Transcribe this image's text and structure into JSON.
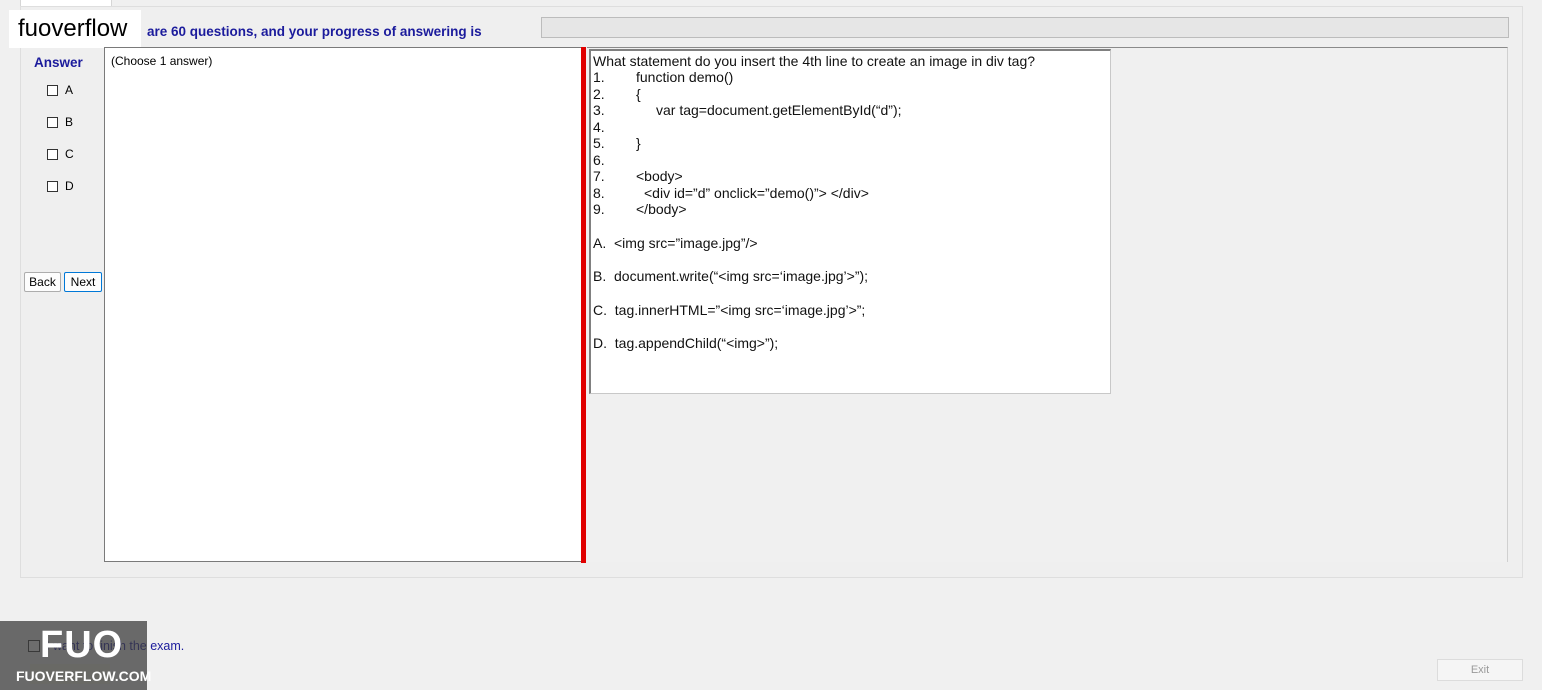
{
  "logo": {
    "text": "fuoverflow"
  },
  "header": {
    "progress_label": "are 60 questions, and your progress of answering is"
  },
  "answer_panel": {
    "title": "Answer",
    "options": [
      "A",
      "B",
      "C",
      "D"
    ]
  },
  "nav": {
    "back_label": "Back",
    "next_label": "Next"
  },
  "choose_panel": {
    "text": "(Choose 1 answer)"
  },
  "question": {
    "stem": "What statement do you insert the 4th line to create an image in div tag?",
    "lines": [
      {
        "num": "1.",
        "code": "function demo()"
      },
      {
        "num": "2.",
        "code": "{"
      },
      {
        "num": "3.",
        "code": "var tag=document.getElementById(“d”);"
      },
      {
        "num": "4.",
        "code": ""
      },
      {
        "num": "5.",
        "code": "}"
      },
      {
        "num": "6.",
        "code": ""
      },
      {
        "num": "7.",
        "code": "<body>"
      },
      {
        "num": "8.",
        "code": "<div id=”d” onclick=”demo()”> </div>"
      },
      {
        "num": "9.",
        "code": "</body>"
      }
    ],
    "choices": [
      "A.  <img src=”image.jpg”/>",
      "B.  document.write(“<img src=‘image.jpg’>”);",
      "C.  tag.innerHTML=”<img src=‘image.jpg’>”;",
      "D.  tag.appendChild(“<img>”);"
    ]
  },
  "footer": {
    "finish_label": "I want to finish the exam.",
    "exit_label": "Exit"
  },
  "watermark": {
    "big": "FUO",
    "small": "FUOVERFLOW.COM"
  }
}
